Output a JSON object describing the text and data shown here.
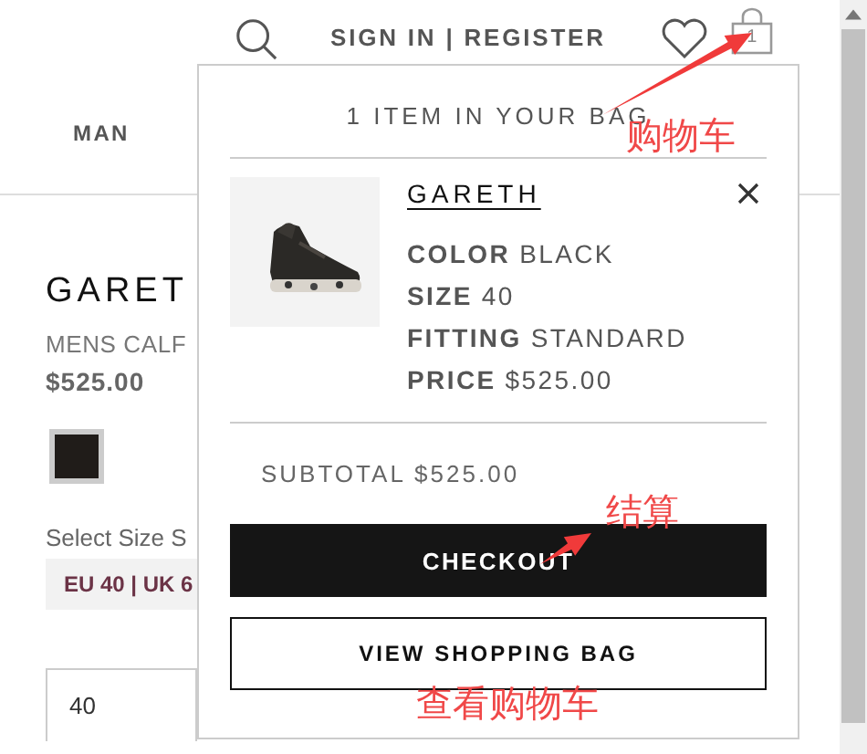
{
  "header": {
    "account_link": "SIGN IN | REGISTER",
    "bag_count": "1"
  },
  "nav": [
    {
      "label": "MAN"
    }
  ],
  "product": {
    "name": "GARET",
    "subtitle": "MENS CALF",
    "price": "$525.00",
    "size_scale_label": "Select Size S",
    "size_chip": "EU 40 | UK 6",
    "size_value": "40"
  },
  "bag": {
    "heading": "1 ITEM IN YOUR BAG",
    "items": [
      {
        "name": "GARETH",
        "details": [
          {
            "label": "COLOR",
            "value": "BLACK"
          },
          {
            "label": "SIZE",
            "value": "40"
          },
          {
            "label": "FITTING",
            "value": "STANDARD"
          },
          {
            "label": "PRICE",
            "value": "$525.00"
          }
        ]
      }
    ],
    "subtotal": "SUBTOTAL $525.00",
    "checkout": "CHECKOUT",
    "view_bag": "VIEW SHOPPING BAG"
  },
  "annotations": [
    {
      "text": "购物车"
    },
    {
      "text": "结算"
    },
    {
      "text": "查看购物车"
    }
  ]
}
